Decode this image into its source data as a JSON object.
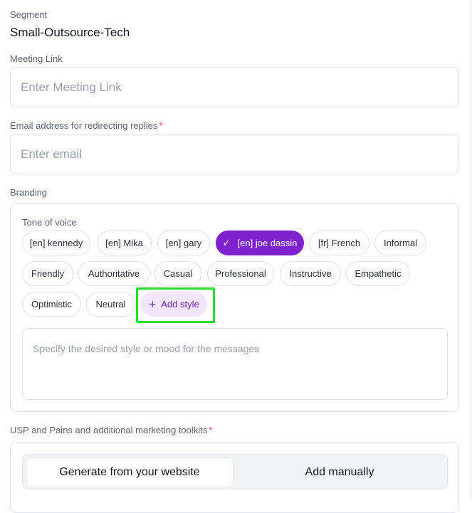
{
  "segment": {
    "label": "Segment",
    "value": "Small-Outsource-Tech"
  },
  "meeting_link": {
    "label": "Meeting Link",
    "placeholder": "Enter Meeting Link"
  },
  "email": {
    "label": "Email address for redirecting replies",
    "required_mark": "*",
    "placeholder": "Enter email"
  },
  "branding": {
    "label": "Branding",
    "tone_label": "Tone of voice",
    "tones": [
      {
        "label": "[en] kennedy",
        "selected": false
      },
      {
        "label": "[en] Mika",
        "selected": false
      },
      {
        "label": "[en] gary",
        "selected": false
      },
      {
        "label": "[en] joe dassin",
        "selected": true
      },
      {
        "label": "[fr] French",
        "selected": false
      },
      {
        "label": "Informal",
        "selected": false
      },
      {
        "label": "Friendly",
        "selected": false
      },
      {
        "label": "Authoritative",
        "selected": false
      },
      {
        "label": "Casual",
        "selected": false
      },
      {
        "label": "Professional",
        "selected": false
      },
      {
        "label": "Instructive",
        "selected": false
      },
      {
        "label": "Empathetic",
        "selected": false
      },
      {
        "label": "Optimistic",
        "selected": false
      },
      {
        "label": "Neutral",
        "selected": false
      }
    ],
    "check_glyph": "✓",
    "add_style": {
      "icon": "plus-icon",
      "glyph": "+",
      "label": "Add style"
    },
    "style_placeholder": "Specify the desired style or mood for the messages"
  },
  "usp": {
    "label": "USP and Pains and additional marketing toolkits",
    "required_mark": "*",
    "tabs": [
      {
        "label": "Generate from your website",
        "active": true
      },
      {
        "label": "Add manually",
        "active": false
      }
    ]
  },
  "colors": {
    "accent": "#7e22ce",
    "accent_soft": "#f1e6fb",
    "highlight": "#22e02c",
    "required": "#e5484d"
  }
}
